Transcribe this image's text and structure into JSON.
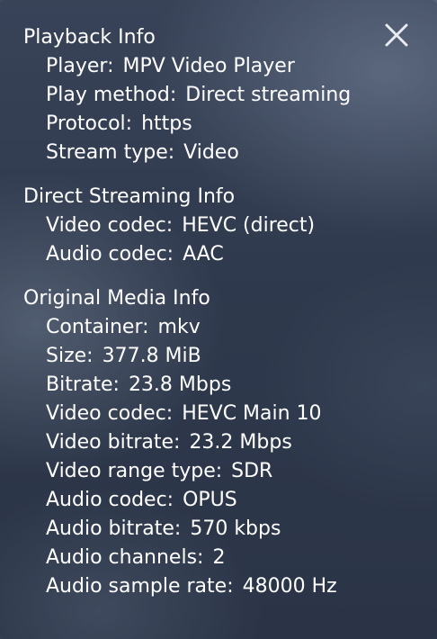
{
  "close_icon": "close-icon",
  "sections": [
    {
      "title": "Playback Info",
      "rows": [
        {
          "label": "Player:",
          "value": "MPV Video Player"
        },
        {
          "label": "Play method:",
          "value": "Direct streaming"
        },
        {
          "label": "Protocol:",
          "value": "https"
        },
        {
          "label": "Stream type:",
          "value": "Video"
        }
      ]
    },
    {
      "title": "Direct Streaming Info",
      "rows": [
        {
          "label": "Video codec:",
          "value": "HEVC (direct)"
        },
        {
          "label": "Audio codec:",
          "value": "AAC"
        }
      ]
    },
    {
      "title": "Original Media Info",
      "rows": [
        {
          "label": "Container:",
          "value": "mkv"
        },
        {
          "label": "Size:",
          "value": "377.8 MiB"
        },
        {
          "label": "Bitrate:",
          "value": "23.8 Mbps"
        },
        {
          "label": "Video codec:",
          "value": "HEVC Main 10"
        },
        {
          "label": "Video bitrate:",
          "value": "23.2 Mbps"
        },
        {
          "label": "Video range type:",
          "value": "SDR"
        },
        {
          "label": "Audio codec:",
          "value": "OPUS"
        },
        {
          "label": "Audio bitrate:",
          "value": "570 kbps"
        },
        {
          "label": "Audio channels:",
          "value": "2"
        },
        {
          "label": "Audio sample rate:",
          "value": "48000 Hz"
        }
      ]
    }
  ]
}
